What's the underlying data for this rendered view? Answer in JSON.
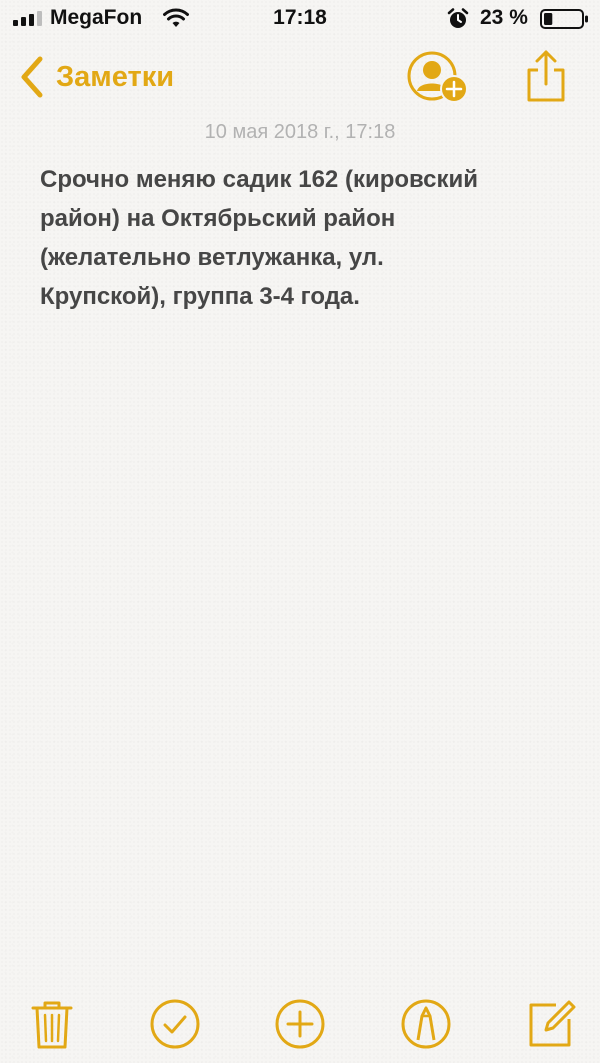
{
  "status_bar": {
    "carrier": "MegaFon",
    "time": "17:18",
    "battery_percent_text": "23 %",
    "battery_level": 0.23,
    "icons": [
      "signal-bars-icon",
      "wifi-icon",
      "alarm-icon",
      "battery-icon"
    ]
  },
  "nav": {
    "back_label": "Заметки",
    "icons": [
      "chevron-left-icon",
      "add-people-icon",
      "share-icon"
    ]
  },
  "note": {
    "date": "10 мая 2018 г., 17:18",
    "body": "Срочно меняю садик 162 (кировский\nрайон) на Октябрьский район\n(желательно ветлужанка, ул.\nКрупской), группа 3-4 года."
  },
  "toolbar": {
    "icons": [
      "trash-icon",
      "checklist-icon",
      "add-icon",
      "markup-icon",
      "compose-icon"
    ]
  },
  "colors": {
    "accent": "#e2a815",
    "background": "#f6f5f3",
    "date_text": "#b2b2b2",
    "body_text": "#464646"
  }
}
